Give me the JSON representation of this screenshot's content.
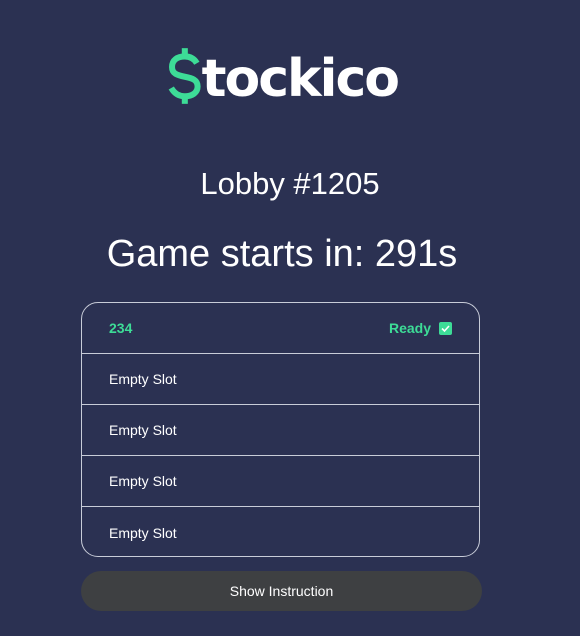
{
  "brand": {
    "logo_text": "tockico",
    "logo_symbol": "dollar-sign-icon",
    "accent_color": "#3ddc97",
    "background_color": "#2b3152"
  },
  "lobby": {
    "title": "Lobby #1205",
    "countdown_label": "Game starts in: 291s"
  },
  "slots": [
    {
      "name": "234",
      "status": "Ready",
      "ready": true
    },
    {
      "name": "Empty Slot",
      "status": "",
      "ready": false
    },
    {
      "name": "Empty Slot",
      "status": "",
      "ready": false
    },
    {
      "name": "Empty Slot",
      "status": "",
      "ready": false
    },
    {
      "name": "Empty Slot",
      "status": "",
      "ready": false
    }
  ],
  "actions": {
    "show_instruction_label": "Show Instruction"
  }
}
